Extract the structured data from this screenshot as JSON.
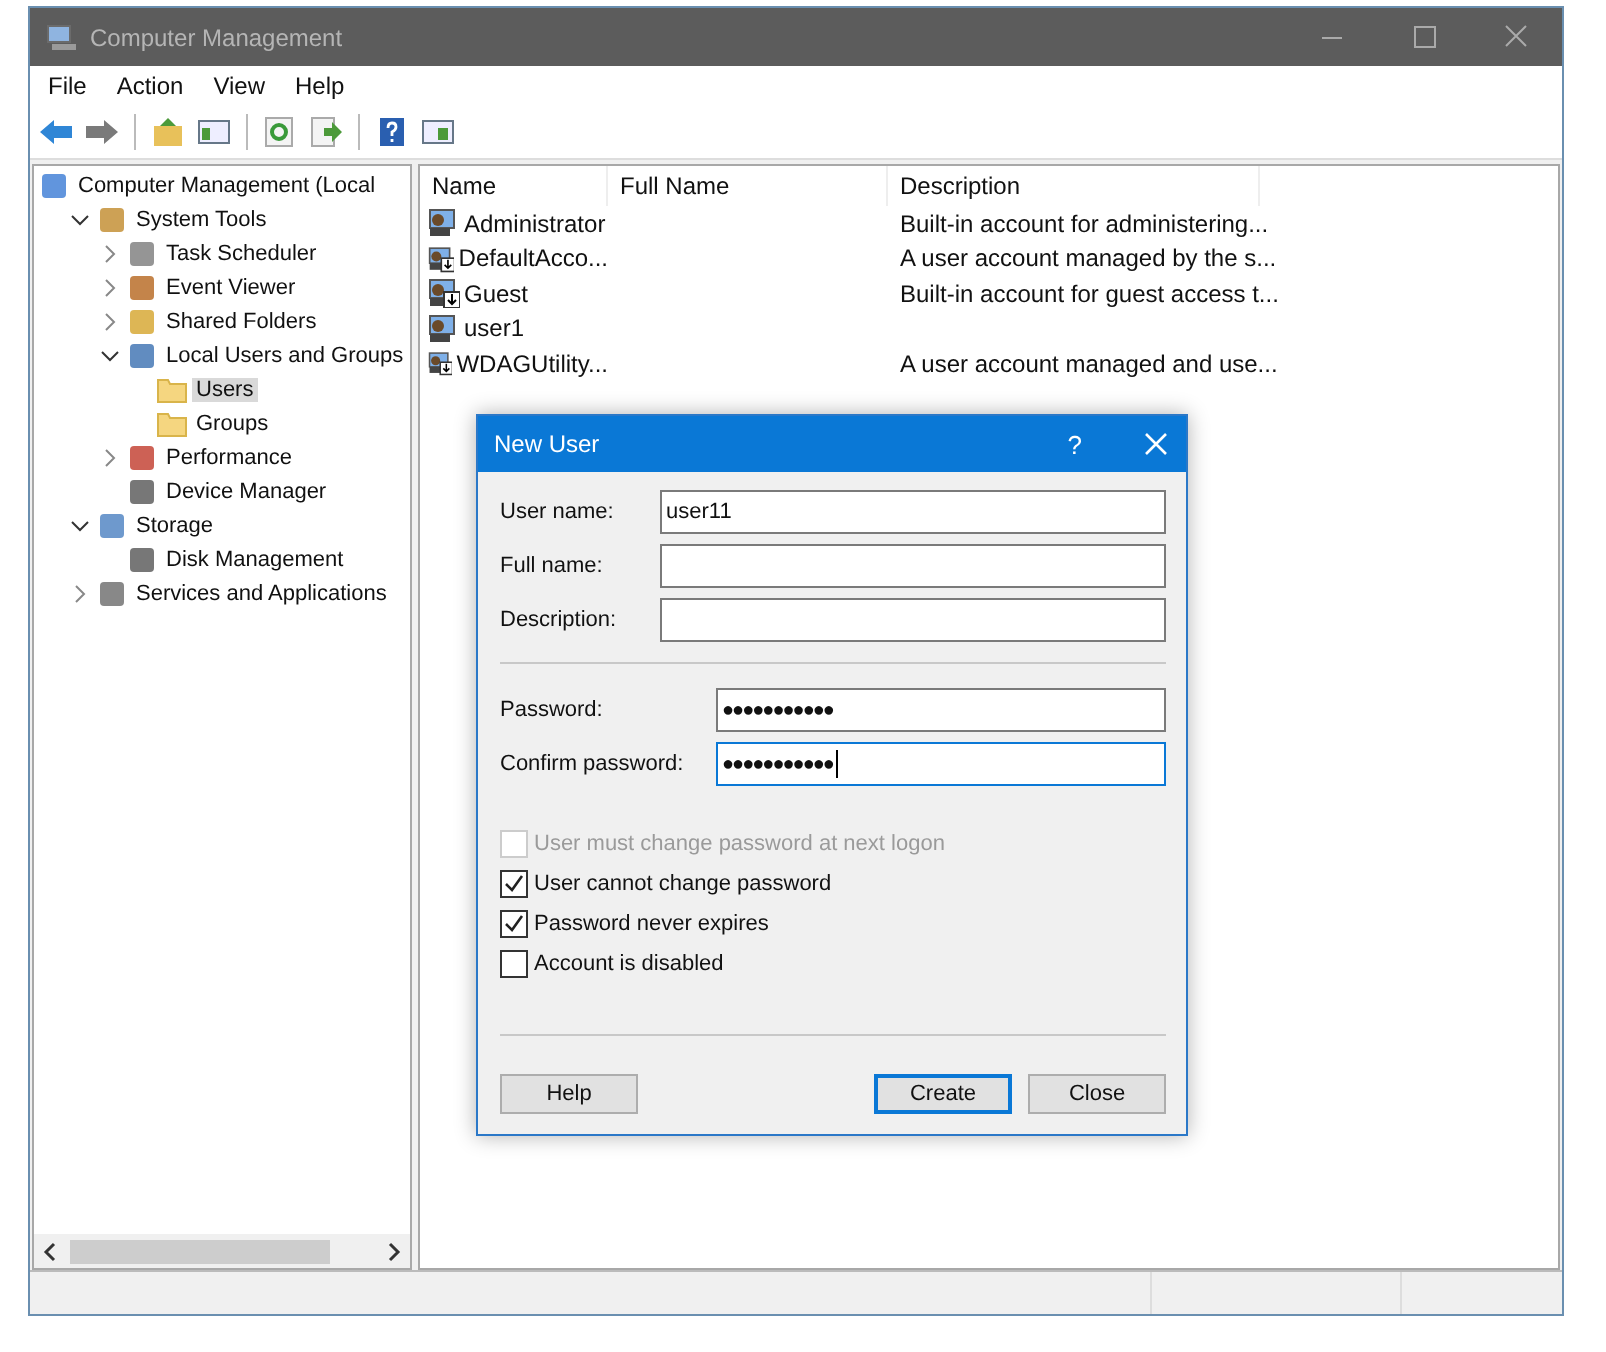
{
  "window": {
    "title": "Computer Management"
  },
  "menu": [
    "File",
    "Action",
    "View",
    "Help"
  ],
  "tree": [
    {
      "label": "Computer Management (Local",
      "kind": "computer",
      "children": [
        {
          "label": "System Tools",
          "kind": "tools",
          "expanded": true,
          "children": [
            {
              "label": "Task Scheduler",
              "kind": "clock",
              "expanded": false
            },
            {
              "label": "Event Viewer",
              "kind": "viewer",
              "expanded": false
            },
            {
              "label": "Shared Folders",
              "kind": "share",
              "expanded": false
            },
            {
              "label": "Local Users and Groups",
              "kind": "users",
              "expanded": true,
              "children": [
                {
                  "label": "Users",
                  "kind": "folder",
                  "selected": true
                },
                {
                  "label": "Groups",
                  "kind": "folder",
                  "selected": false
                }
              ]
            },
            {
              "label": "Performance",
              "kind": "gauge",
              "expanded": false
            },
            {
              "label": "Device Manager",
              "kind": "device"
            }
          ]
        },
        {
          "label": "Storage",
          "kind": "storage",
          "expanded": true,
          "children": [
            {
              "label": "Disk Management",
              "kind": "disk"
            }
          ]
        },
        {
          "label": "Services and Applications",
          "kind": "services",
          "expanded": false
        }
      ]
    }
  ],
  "table": {
    "columns": [
      "Name",
      "Full Name",
      "Description"
    ],
    "rows": [
      {
        "name": "Administrator",
        "description": "Built-in account for administering...",
        "disabled": false
      },
      {
        "name": "DefaultAcco...",
        "description": "A user account managed by the s...",
        "disabled": true
      },
      {
        "name": "Guest",
        "description": "Built-in account for guest access t...",
        "disabled": true
      },
      {
        "name": "user1",
        "disabled": false
      },
      {
        "name": "WDAGUtility...",
        "description": "A user account managed and use...",
        "disabled": true
      }
    ]
  },
  "dialog": {
    "title": "New User",
    "help_glyph": "?",
    "account_fields": [
      {
        "label": "User name:",
        "value": "user11",
        "focused": false
      },
      {
        "label": "Full name:",
        "focused": false
      },
      {
        "label": "Description:",
        "focused": false
      }
    ],
    "password_fields": [
      {
        "label": "Password:",
        "value": "●●●●●●●●●●●",
        "focused": false
      },
      {
        "label": "Confirm password:",
        "value": "●●●●●●●●●●●",
        "focused": true
      }
    ],
    "options": [
      {
        "label": "User must change password at next logon",
        "checked": false,
        "disabled": true
      },
      {
        "label": "User cannot change password",
        "checked": true,
        "disabled": false
      },
      {
        "label": "Password never expires",
        "checked": true,
        "disabled": false
      },
      {
        "label": "Account is disabled",
        "checked": false,
        "disabled": false
      }
    ],
    "buttons": [
      {
        "label": "Help",
        "default": false
      },
      {
        "label": "Create",
        "default": true
      },
      {
        "label": "Close",
        "default": false
      }
    ]
  }
}
